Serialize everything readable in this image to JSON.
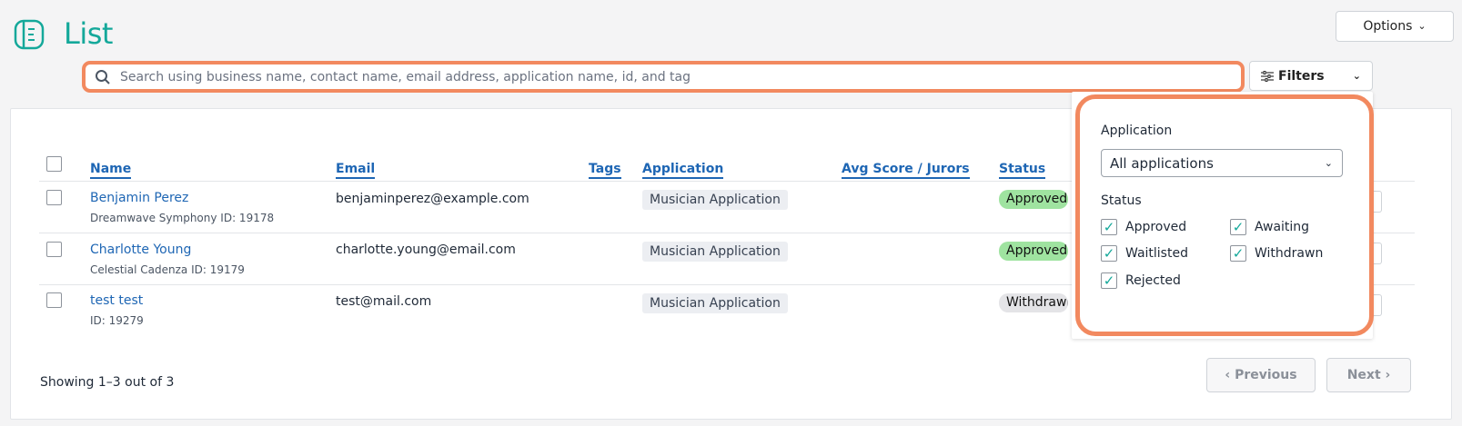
{
  "header": {
    "title": "List",
    "options_label": "Options"
  },
  "search": {
    "placeholder": "Search using business name, contact name, email address, application name, id, and tag"
  },
  "filters": {
    "label": "Filters",
    "application_label": "Application",
    "application_selected": "All applications",
    "status_label": "Status",
    "statuses": [
      {
        "label": "Approved",
        "checked": true
      },
      {
        "label": "Awaiting",
        "checked": true
      },
      {
        "label": "Waitlisted",
        "checked": true
      },
      {
        "label": "Withdrawn",
        "checked": true
      },
      {
        "label": "Rejected",
        "checked": true
      }
    ]
  },
  "table": {
    "columns": [
      "Name",
      "Email",
      "Tags",
      "Application",
      "Avg Score / Jurors",
      "Status"
    ],
    "rows": [
      {
        "name": "Benjamin Perez",
        "sub": "Dreamwave Symphony ID: 19178",
        "email": "benjaminperez@example.com",
        "application": "Musician Application",
        "status": "Approved"
      },
      {
        "name": "Charlotte Young",
        "sub": "Celestial Cadenza ID: 19179",
        "email": "charlotte.young@email.com",
        "application": "Musician Application",
        "status": "Approved"
      },
      {
        "name": "test test",
        "sub": "ID: 19279",
        "email": "test@mail.com",
        "application": "Musician Application",
        "status": "Withdrawn"
      }
    ]
  },
  "footer": {
    "showing": "Showing 1–3 out of 3",
    "previous": "‹ Previous",
    "next": "Next ›"
  },
  "colors": {
    "accent": "#14a89a",
    "link": "#1e66b4",
    "highlight": "#f2895f",
    "approved_bg": "#9fe3a0",
    "withdrawn_bg": "#e4e4e7"
  }
}
